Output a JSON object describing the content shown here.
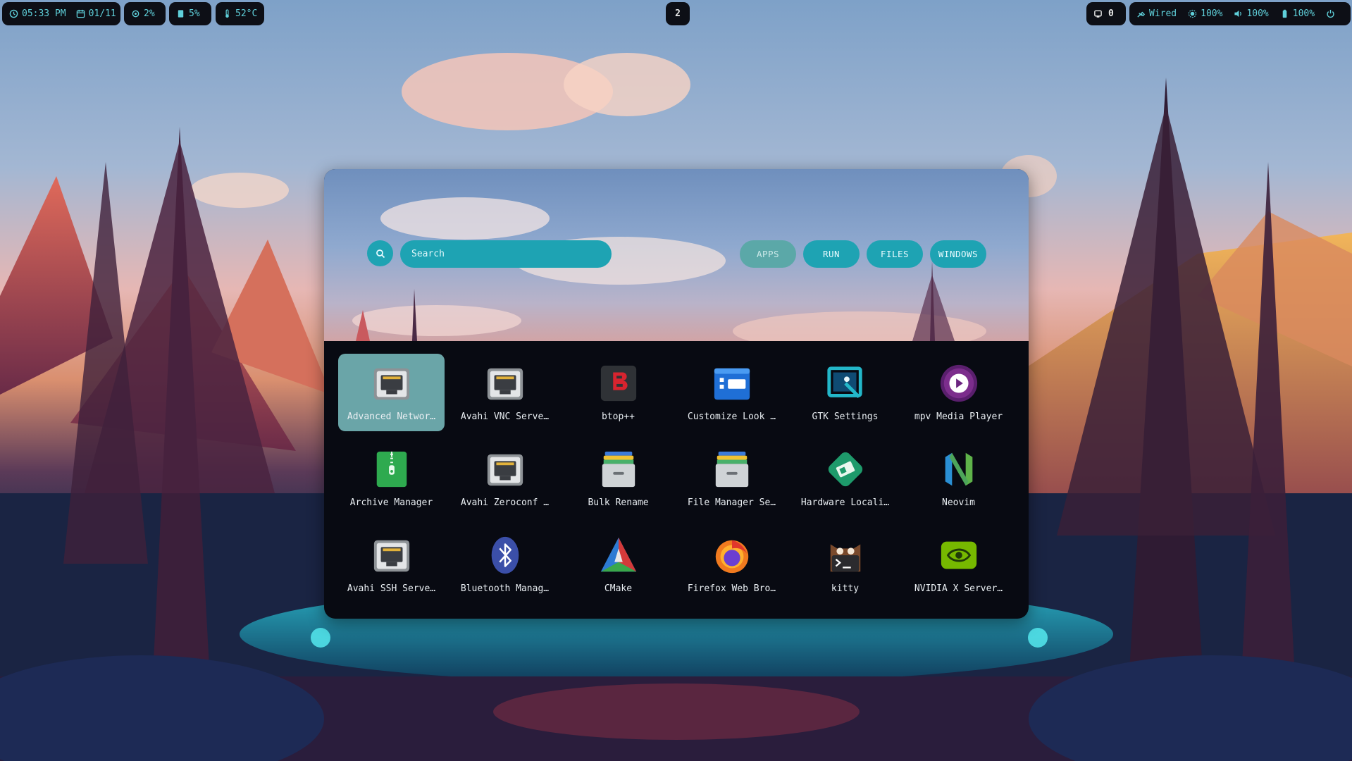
{
  "topbar": {
    "left": {
      "time": "05:33 PM",
      "date": "01/11",
      "cpu": "2%",
      "memory": "5%",
      "temperature": "52°C"
    },
    "workspace": "2",
    "right": {
      "notifications": "0",
      "network": "Wired",
      "brightness": "100%",
      "volume": "100%",
      "battery": "100%"
    }
  },
  "launcher": {
    "search": {
      "placeholder": "Search",
      "value": ""
    },
    "modes": [
      {
        "label": "APPS",
        "active": true
      },
      {
        "label": "RUN",
        "active": false
      },
      {
        "label": "FILES",
        "active": false
      },
      {
        "label": "WINDOWS",
        "active": false
      }
    ],
    "apps": [
      {
        "label": "Advanced Networ…",
        "icon": "network-ethernet-icon",
        "selected": true
      },
      {
        "label": "Avahi VNC Serve…",
        "icon": "network-ethernet-icon"
      },
      {
        "label": "btop++",
        "icon": "btop-icon"
      },
      {
        "label": "Customize Look …",
        "icon": "appearance-icon"
      },
      {
        "label": "GTK Settings",
        "icon": "gtk-settings-icon"
      },
      {
        "label": "mpv Media Player",
        "icon": "mpv-icon"
      },
      {
        "label": "Archive Manager",
        "icon": "archive-icon"
      },
      {
        "label": "Avahi Zeroconf …",
        "icon": "network-ethernet-icon"
      },
      {
        "label": "Bulk Rename",
        "icon": "file-cabinet-icon"
      },
      {
        "label": "File Manager Se…",
        "icon": "file-cabinet-icon"
      },
      {
        "label": "Hardware Locali…",
        "icon": "hardware-icon"
      },
      {
        "label": "Neovim",
        "icon": "neovim-icon"
      },
      {
        "label": "Avahi SSH Serve…",
        "icon": "network-ethernet-icon"
      },
      {
        "label": "Bluetooth Manag…",
        "icon": "bluetooth-icon"
      },
      {
        "label": "CMake",
        "icon": "cmake-icon"
      },
      {
        "label": "Firefox Web Bro…",
        "icon": "firefox-icon"
      },
      {
        "label": "kitty",
        "icon": "kitty-icon"
      },
      {
        "label": "NVIDIA X Server…",
        "icon": "nvidia-icon"
      }
    ]
  },
  "colors": {
    "accent": "#1ea3b3",
    "selected": "#6aa5a8",
    "bar_text": "#5fd0da",
    "panel_bg": "#080a12"
  }
}
